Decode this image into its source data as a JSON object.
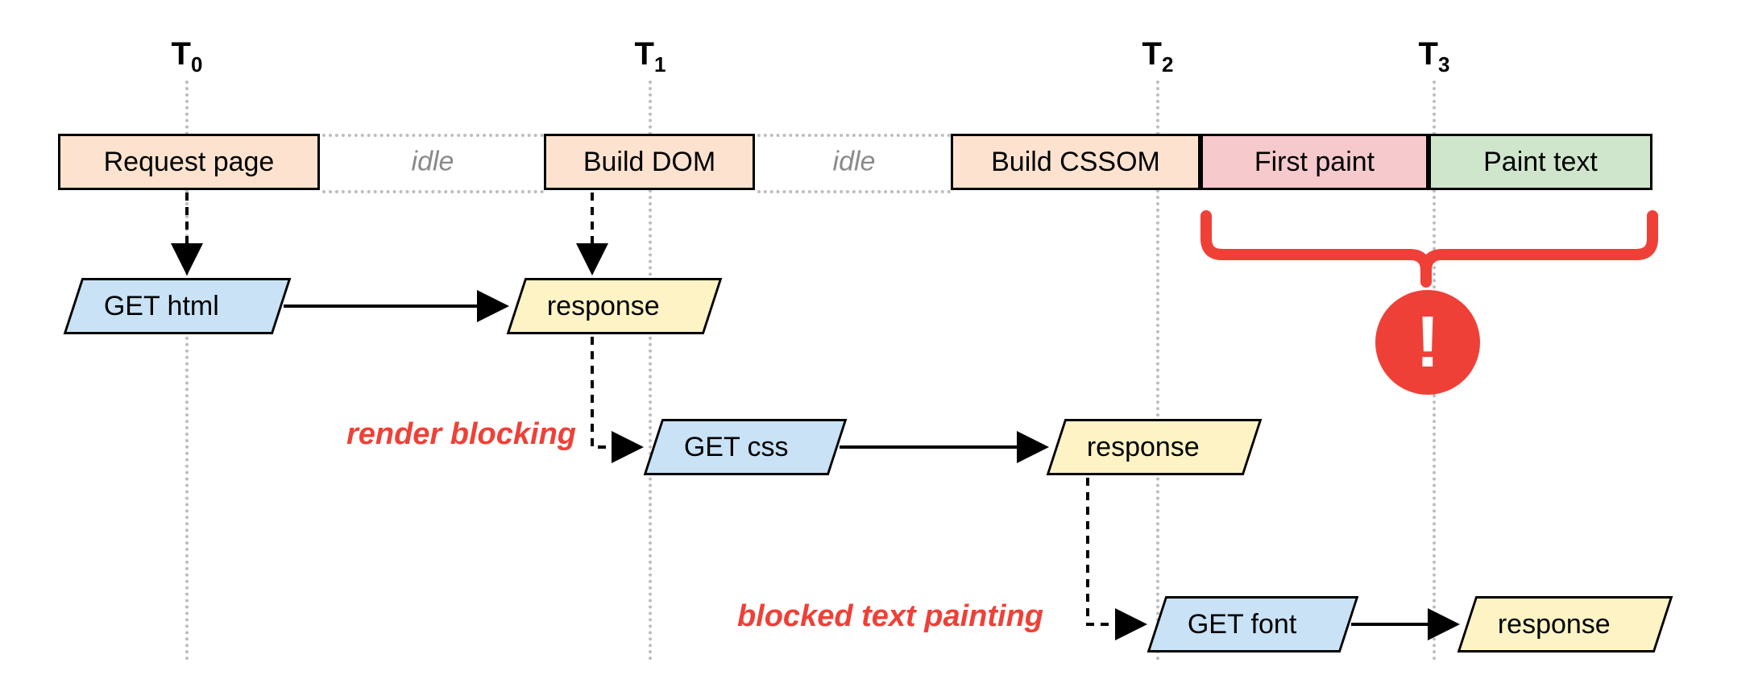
{
  "timeline": {
    "t0": "T",
    "t0s": "0",
    "t1": "T",
    "t1s": "1",
    "t2": "T",
    "t2s": "2",
    "t3": "T",
    "t3s": "3"
  },
  "boxes": {
    "request_page": "Request page",
    "build_dom": "Build DOM",
    "build_cssom": "Build CSSOM",
    "first_paint": "First paint",
    "paint_text": "Paint text"
  },
  "paras": {
    "get_html": "GET html",
    "response1": "response",
    "get_css": "GET css",
    "response2": "response",
    "get_font": "GET font",
    "response3": "response"
  },
  "idle": "idle",
  "annot": {
    "render_blocking": "render blocking",
    "blocked_text": "blocked text painting"
  },
  "alert": "!",
  "colors": {
    "peach": "#fde3cf",
    "pink": "#f6c9cd",
    "green": "#cfe6cd",
    "blue": "#c9e2f5",
    "yellow": "#fdf3c4",
    "red": "#ef4037"
  }
}
